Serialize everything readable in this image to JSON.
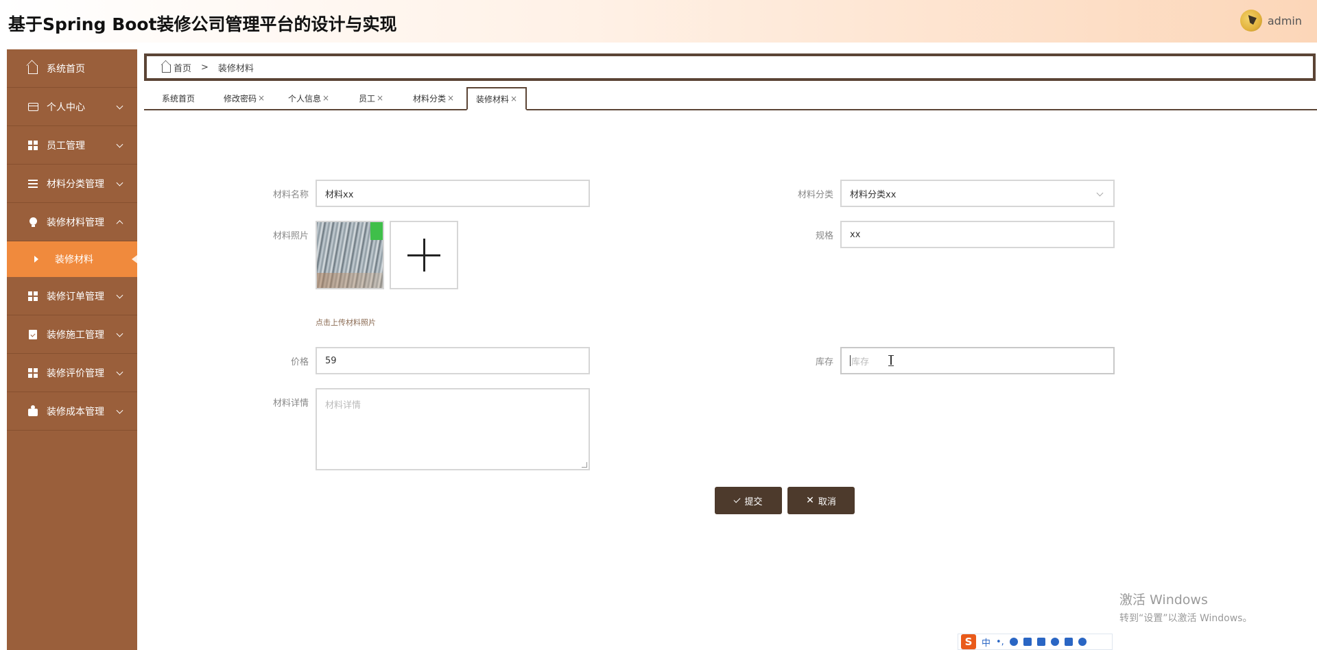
{
  "app": {
    "title": "基于Spring Boot装修公司管理平台的设计与实现",
    "user_name": "admin"
  },
  "sidebar": {
    "items": [
      {
        "label": "系统首页",
        "icon": "home-icon",
        "expandable": false
      },
      {
        "label": "个人中心",
        "icon": "card-icon",
        "expandable": true
      },
      {
        "label": "员工管理",
        "icon": "grid-icon",
        "expandable": true
      },
      {
        "label": "材料分类管理",
        "icon": "list-icon",
        "expandable": true
      },
      {
        "label": "装修材料管理",
        "icon": "bulb-icon",
        "expandable": true,
        "expanded": true
      },
      {
        "label": "装修订单管理",
        "icon": "grid-icon",
        "expandable": true
      },
      {
        "label": "装修施工管理",
        "icon": "clipboard-icon",
        "expandable": true
      },
      {
        "label": "装修评价管理",
        "icon": "grid-icon",
        "expandable": true
      },
      {
        "label": "装修成本管理",
        "icon": "coin-icon",
        "expandable": true
      }
    ],
    "active_subitem": {
      "label": "装修材料"
    }
  },
  "breadcrumb": {
    "home": "首页",
    "separator": ">",
    "current": "装修材料"
  },
  "tabs": [
    {
      "label": "系统首页",
      "closable": false
    },
    {
      "label": "修改密码",
      "closable": true
    },
    {
      "label": "个人信息",
      "closable": true
    },
    {
      "label": "员工",
      "closable": true
    },
    {
      "label": "材料分类",
      "closable": true
    },
    {
      "label": "装修材料",
      "closable": true,
      "active": true
    }
  ],
  "tab_close_symbol": "×",
  "form": {
    "name": {
      "label": "材料名称",
      "value": "材料xx"
    },
    "category": {
      "label": "材料分类",
      "value": "材料分类xx"
    },
    "photo": {
      "label": "材料照片",
      "upload_hint": "点击上传材料照片"
    },
    "spec": {
      "label": "规格",
      "value": "xx"
    },
    "price": {
      "label": "价格",
      "value": "59"
    },
    "stock": {
      "label": "库存",
      "placeholder": "库存"
    },
    "detail": {
      "label": "材料详情",
      "placeholder": "材料详情"
    },
    "submit_label": "提交",
    "cancel_label": "取消"
  },
  "watermark": {
    "line1": "激活 Windows",
    "line2": "转到“设置”以激活 Windows。"
  },
  "ime": {
    "logo": "S",
    "mode": "中",
    "punct": "•,"
  },
  "colors": {
    "sidebar_bg": "#9a5f3b",
    "sidebar_active": "#f08a3d",
    "dark_brown": "#4d3a2c",
    "border_brown": "#5b4435"
  }
}
